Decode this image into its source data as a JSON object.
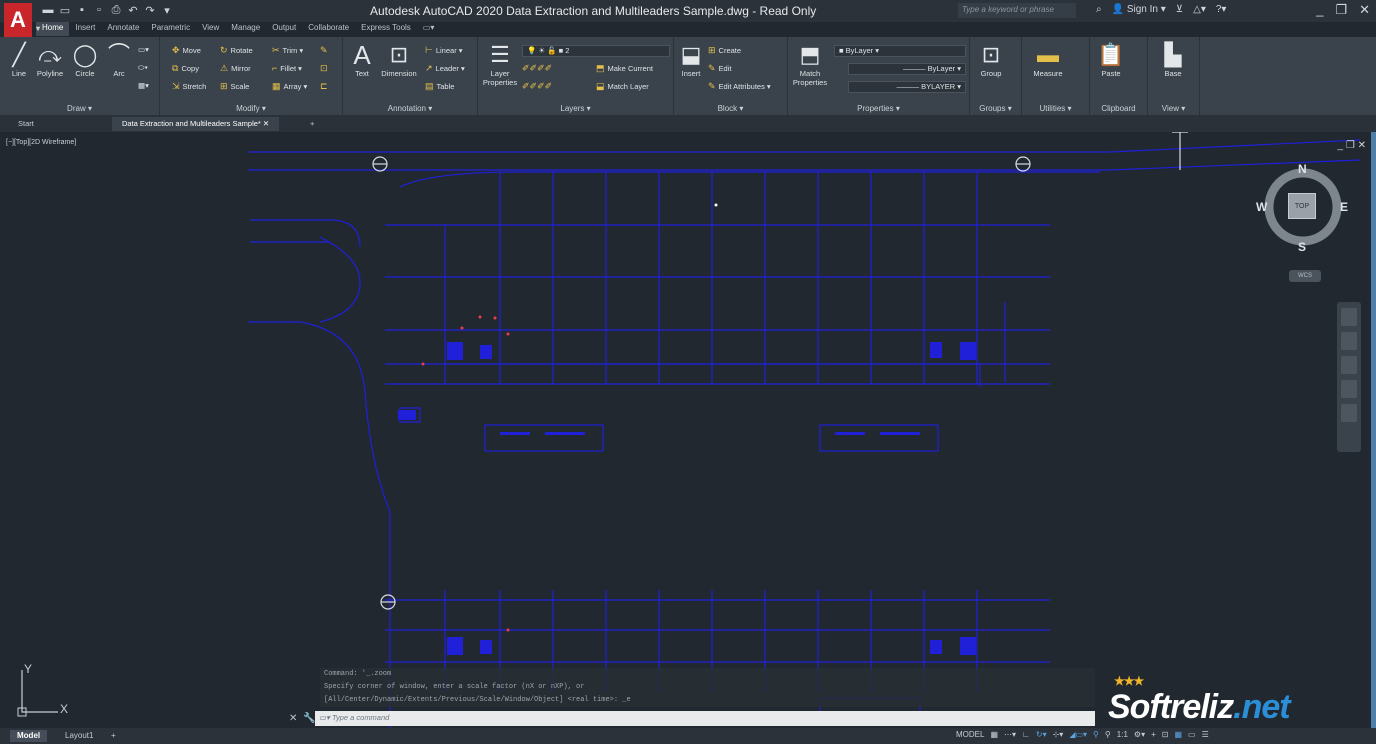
{
  "app": {
    "title": "Autodesk AutoCAD 2020   Data Extraction and Multileaders Sample.dwg - Read Only",
    "logo": "A",
    "search_placeholder": "Type a keyword or phrase",
    "sign_in": "Sign In"
  },
  "ribbon_tabs": [
    "Home",
    "Insert",
    "Annotate",
    "Parametric",
    "View",
    "Manage",
    "Output",
    "Collaborate",
    "Express Tools"
  ],
  "ribbon": {
    "draw": {
      "title": "Draw ▾",
      "line": "Line",
      "polyline": "Polyline",
      "circle": "Circle",
      "arc": "Arc"
    },
    "modify": {
      "title": "Modify ▾",
      "move": "Move",
      "rotate": "Rotate",
      "trim": "Trim ▾",
      "copy": "Copy",
      "mirror": "Mirror",
      "fillet": "Fillet ▾",
      "stretch": "Stretch",
      "scale": "Scale",
      "array": "Array ▾"
    },
    "annotation": {
      "title": "Annotation ▾",
      "text": "Text",
      "dimension": "Dimension",
      "linear": "Linear ▾",
      "leader": "Leader ▾",
      "table": "Table"
    },
    "layers": {
      "title": "Layers ▾",
      "layer_properties": "Layer Properties",
      "current_layer": "2",
      "make_current": "Make Current",
      "match_layer": "Match Layer"
    },
    "block": {
      "title": "Block ▾",
      "insert": "Insert",
      "create": "Create",
      "edit": "Edit",
      "edit_attributes": "Edit Attributes ▾"
    },
    "properties": {
      "title": "Properties ▾",
      "match_properties": "Match Properties",
      "color": "ByLayer",
      "linetype": "ByLayer",
      "lineweight": "BYLAYER"
    },
    "groups": {
      "title": "Groups ▾",
      "group": "Group"
    },
    "utilities": {
      "title": "Utilities ▾",
      "measure": "Measure"
    },
    "clipboard": {
      "title": "Clipboard",
      "paste": "Paste"
    },
    "view": {
      "title": "View ▾",
      "base": "Base"
    }
  },
  "file_tabs": {
    "start": "Start",
    "active": "Data Extraction and Multileaders Sample*"
  },
  "viewport": {
    "label": "[−][Top][2D Wireframe]",
    "viewcube": {
      "n": "N",
      "s": "S",
      "e": "E",
      "w": "W",
      "top": "TOP",
      "wcs": "WCS"
    },
    "ucs_x": "X",
    "ucs_y": "Y"
  },
  "command": {
    "history": [
      "Command: '_.zoom",
      "Specify corner of window, enter a scale factor (nX or nXP), or",
      "[All/Center/Dynamic/Extents/Previous/Scale/Window/Object] <real time>: _e"
    ],
    "placeholder": "Type a command"
  },
  "watermark": {
    "text": "Softreliz",
    "suffix": ".net"
  },
  "status": {
    "model_tab": "Model",
    "layout_tab": "Layout1",
    "model_label": "MODEL",
    "scale": "1:1"
  },
  "colors": {
    "drawing": "#1f1fd8",
    "background": "#212830",
    "accent": "#c8262b"
  }
}
